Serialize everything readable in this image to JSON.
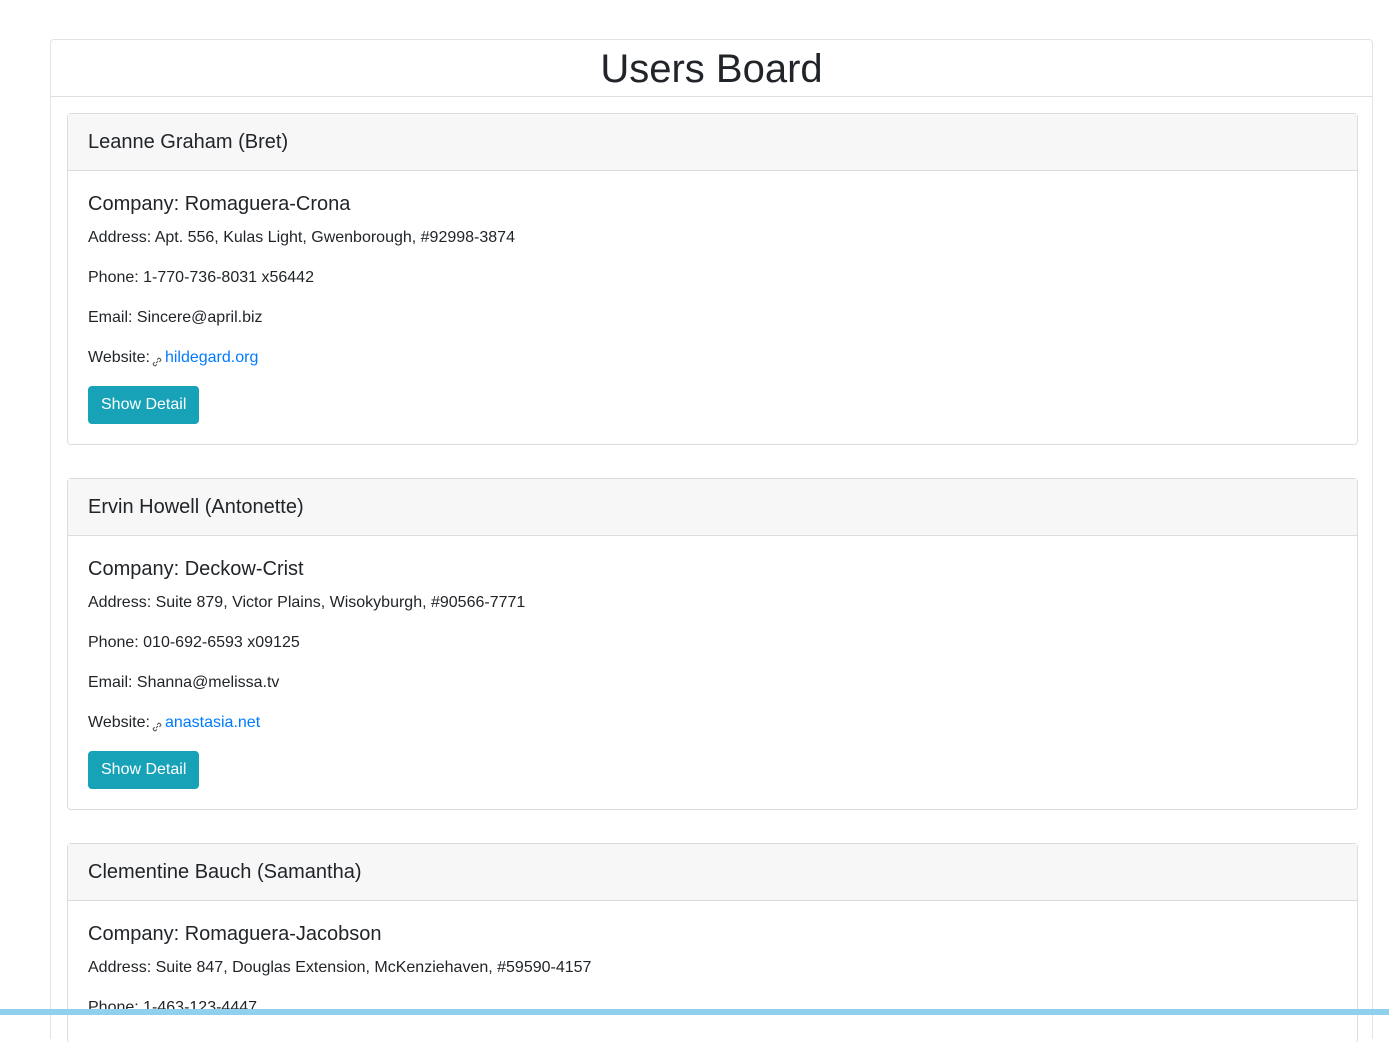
{
  "board": {
    "title": "Users Board"
  },
  "users": [
    {
      "name": "Leanne Graham (Bret)",
      "company": "Company: Romaguera-Crona",
      "address": "Address: Apt. 556, Kulas Light, Gwenborough, #92998-3874",
      "phone": "Phone: 1-770-736-8031 x56442",
      "email": "Email: Sincere@april.biz",
      "website_label": "Website:",
      "website": "hildegard.org",
      "button": "Show Detail"
    },
    {
      "name": "Ervin Howell (Antonette)",
      "company": "Company: Deckow-Crist",
      "address": "Address: Suite 879, Victor Plains, Wisokyburgh, #90566-7771",
      "phone": "Phone: 010-692-6593 x09125",
      "email": "Email: Shanna@melissa.tv",
      "website_label": "Website:",
      "website": "anastasia.net",
      "button": "Show Detail"
    },
    {
      "name": "Clementine Bauch (Samantha)",
      "company": "Company: Romaguera-Jacobson",
      "address": "Address: Suite 847, Douglas Extension, McKenziehaven, #59590-4157",
      "phone": "Phone: 1-463-123-4447"
    }
  ],
  "colors": {
    "button": "#17a2b8",
    "link": "#007bff",
    "card_header": "#f7f7f7"
  }
}
